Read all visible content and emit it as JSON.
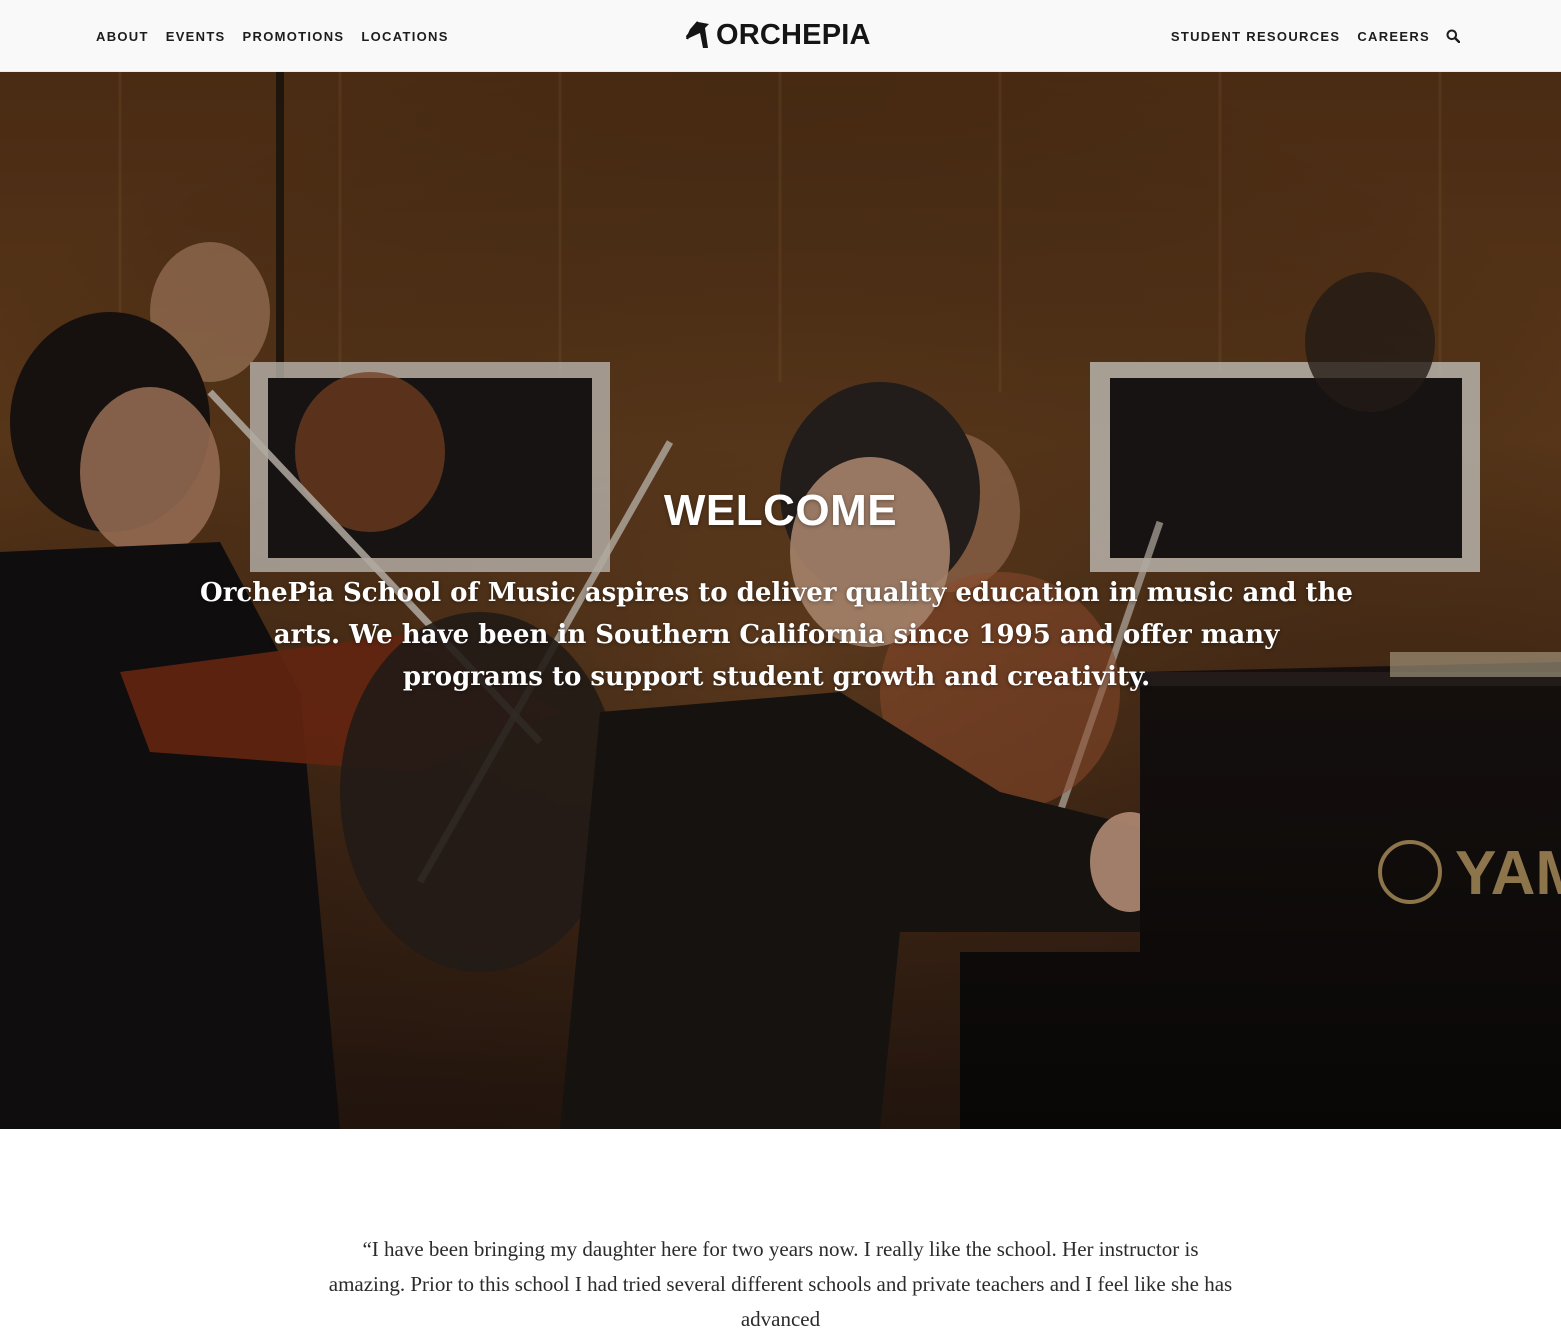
{
  "header": {
    "nav_left": [
      {
        "label": "ABOUT"
      },
      {
        "label": "EVENTS"
      },
      {
        "label": "PROMOTIONS"
      },
      {
        "label": "LOCATIONS"
      }
    ],
    "logo_text": "ORCHEPIA",
    "nav_right": [
      {
        "label": "STUDENT RESOURCES"
      },
      {
        "label": "CAREERS"
      }
    ],
    "search_icon": "search-icon"
  },
  "hero": {
    "title": "WELCOME",
    "text": "OrchePia School of Music aspires to deliver quality education in music and the arts. We have been in Southern California since 1995 and offer many programs to support student growth and creativity.",
    "piano_brand": "YAM"
  },
  "testimonial": {
    "text": "“I have been bringing my daughter here for two years now. I really like the school. Her instructor is amazing. Prior to this school I had tried several different schools and private teachers and I feel like she has advanced"
  },
  "colors": {
    "header_bg": "#f9f9f9",
    "nav_text": "#1d1d1d",
    "hero_text": "#ffffff",
    "body_text": "#2b2b2b"
  }
}
